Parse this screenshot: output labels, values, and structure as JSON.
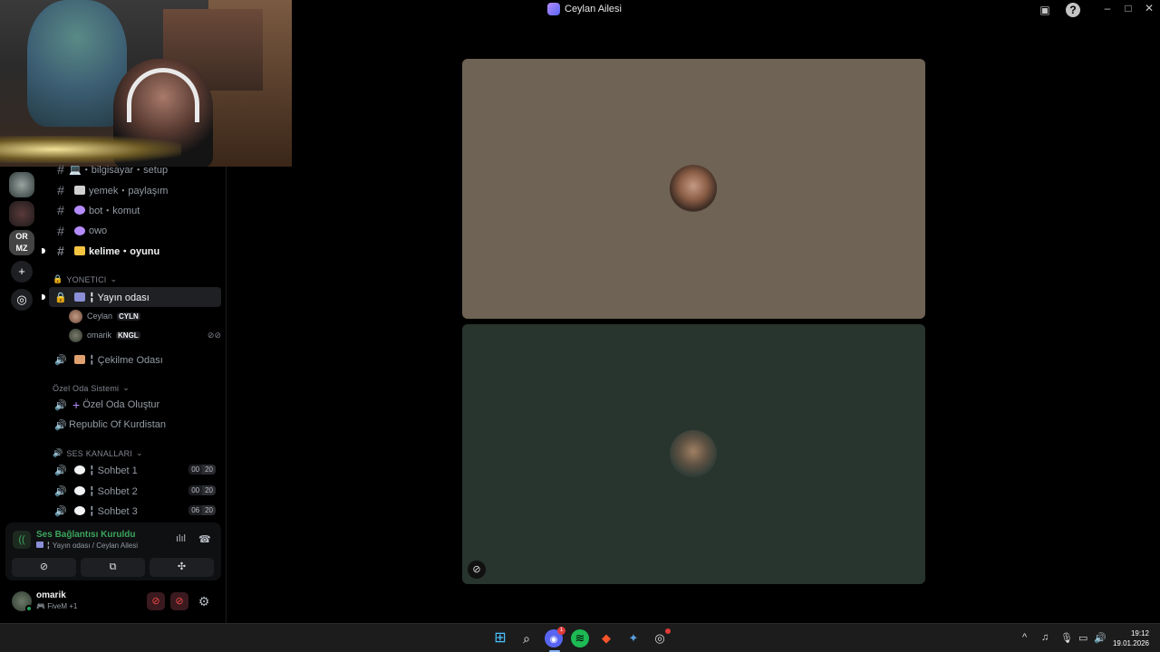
{
  "window": {
    "title": "Ceylan Ailesi"
  },
  "channels": [
    {
      "name": "💻・bilgisayar・setup",
      "emoji_color": "#5b8fd9"
    },
    {
      "name": "yemek・paylaşım",
      "emoji_color": "#d0d0d0"
    },
    {
      "name": "bot・komut",
      "emoji_color": "#b58cff"
    },
    {
      "name": "owo",
      "emoji_color": "#b58cff"
    },
    {
      "name": "kelime・oyunu",
      "emoji_color": "#f5c542",
      "bold": true
    }
  ],
  "categories": {
    "yonetici": "YONETICI",
    "ozel": "Özel Oda Sistemi",
    "ses": "SES KANALLARI"
  },
  "voice_channels": {
    "yayin": "╏ Yayın odası",
    "cekilme": "╏ Çekilme Odası",
    "ozel_olustur": "Özel Oda Oluştur",
    "republic": "Republic Of Kurdistan"
  },
  "voice_users": [
    {
      "name": "Ceylan",
      "tag": "CYLN"
    },
    {
      "name": "omarik",
      "tag": "KNGL"
    }
  ],
  "sohbet": [
    {
      "name": "╏ Sohbet 1",
      "count": "00",
      "limit": "20"
    },
    {
      "name": "╏ Sohbet 2",
      "count": "00",
      "limit": "20"
    },
    {
      "name": "╏ Sohbet 3",
      "count": "06",
      "limit": "20"
    }
  ],
  "voice_panel": {
    "status": "Ses Bağlantısı Kuruldu",
    "location": "╏ Yayın odası / Ceylan Ailesi"
  },
  "user_panel": {
    "name": "omarik",
    "activity": "FiveM",
    "extra": "+1"
  },
  "server_rail": [
    "OR MZ"
  ],
  "taskbar": {
    "time": "19:12",
    "date": "19.01.2026",
    "discord_badge": "1"
  },
  "colors": {
    "accent_green": "#3ba55c",
    "tile1_bg": "#6e6354",
    "tile2_bg": "#28342e"
  },
  "icons": [
    "discord-logo-icon",
    "inbox-icon",
    "help-icon",
    "minimize-icon",
    "maximize-icon",
    "close-icon",
    "hash-icon",
    "speaker-icon",
    "lock-icon",
    "plus-icon",
    "compass-icon",
    "signal-icon",
    "waveform-icon",
    "disconnect-icon",
    "video-off-icon",
    "screenshare-icon",
    "activities-icon",
    "mute-icon",
    "deafen-icon",
    "gear-icon"
  ]
}
